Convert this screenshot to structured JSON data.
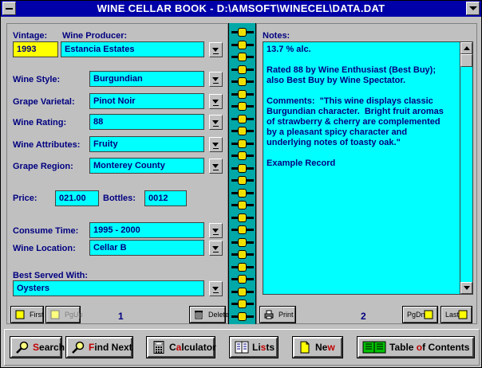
{
  "window": {
    "title": "WINE CELLAR BOOK - D:\\AMSOFT\\WINECEL\\DATA.DAT"
  },
  "record": {
    "vintage_label": "Vintage:",
    "vintage": "1993",
    "producer_label": "Wine Producer:",
    "producer": "Estancia Estates",
    "style_label": "Wine Style:",
    "style": "Burgundian",
    "varietal_label": "Grape Varietal:",
    "varietal": "Pinot Noir",
    "rating_label": "Wine Rating:",
    "rating": "88",
    "attributes_label": "Wine Attributes:",
    "attributes": "Fruity",
    "region_label": "Grape Region:",
    "region": "Monterey County",
    "price_label": "Price:",
    "price": "021.00",
    "bottles_label": "Bottles:",
    "bottles": "0012",
    "consume_label": "Consume Time:",
    "consume": "1995 - 2000",
    "location_label": "Wine Location:",
    "location": "Cellar B",
    "served_label": "Best Served With:",
    "served": "Oysters"
  },
  "notes": {
    "label": "Notes:",
    "text": "13.7 % alc.\n\nRated 88 by Wine Enthusiast (Best Buy);\nalso Best Buy by Wine Spectator.\n\nComments:  \"This wine displays classic\nBurgundian character.  Bright fruit aromas\nof strawberry & cherry are complemented\nby a pleasant spicy character and\nunderlying notes of toasty oak.\"\n\nExample Record"
  },
  "nav": {
    "first": "First",
    "pgup": "PgUp",
    "delete": "Delete",
    "print": "Print",
    "pgdn": "PgDn",
    "last": "Last",
    "page_left": "1",
    "page_right": "2"
  },
  "toolbar": {
    "search_hot": "S",
    "search_rest": "earch",
    "find_hot": "F",
    "find_rest": "ind Next",
    "calc_pre": "C",
    "calc_hot": "a",
    "calc_rest": "lculator",
    "lists_pre": "Li",
    "lists_hot": "s",
    "lists_rest": "ts",
    "new_pre": "Ne",
    "new_hot": "w",
    "toc_pre": "Table ",
    "toc_hot": "o",
    "toc_rest": "f Contents"
  },
  "colors": {
    "title_bar": "#0000a8",
    "field_bg": "#00ffff",
    "vintage_bg": "#ffff00",
    "spiral": "#00a8a8",
    "text": "#000080"
  }
}
